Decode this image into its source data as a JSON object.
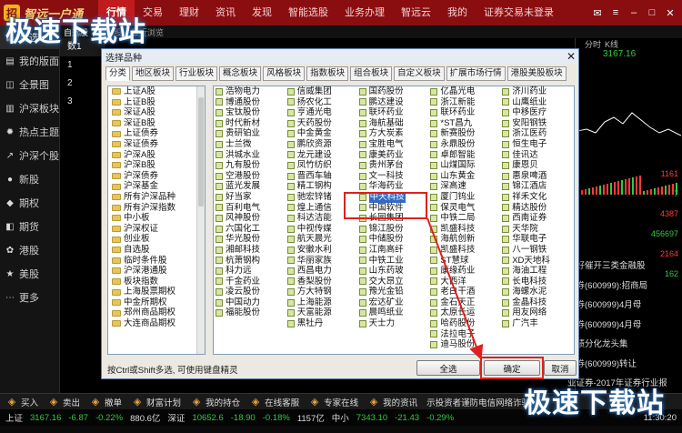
{
  "app": {
    "logo_text": "智远一户通",
    "logo_mark": "招"
  },
  "topnav": {
    "items": [
      "行情",
      "交易",
      "理财",
      "资讯",
      "发现",
      "智能选股",
      "业务办理",
      "智远云",
      "我的",
      "证券交易未登录"
    ],
    "active_index": 0
  },
  "sidebar": {
    "items": [
      {
        "label": "自选",
        "icon": "grid-icon"
      },
      {
        "label": "我的版面",
        "icon": "layout-icon"
      },
      {
        "label": "全景图",
        "icon": "panorama-icon"
      },
      {
        "label": "沪深板块",
        "icon": "block-icon"
      },
      {
        "label": "热点主题",
        "icon": "fire-icon"
      },
      {
        "label": "沪深个股",
        "icon": "chart-icon"
      },
      {
        "label": "新股",
        "icon": "new-icon"
      },
      {
        "label": "期权",
        "icon": "option-icon"
      },
      {
        "label": "期货",
        "icon": "futures-icon"
      },
      {
        "label": "港股",
        "icon": "hk-icon"
      },
      {
        "label": "美股",
        "icon": "us-icon"
      },
      {
        "label": "更多",
        "icon": "more-icon"
      }
    ]
  },
  "subtabs": [
    "自选股",
    "持仓股",
    "最近浏览"
  ],
  "main_table": {
    "header": "数1",
    "rows": [
      "1",
      "2",
      "3"
    ]
  },
  "right_panel": {
    "tabs": [
      "分时",
      "K线"
    ],
    "price": "3167.16",
    "numbers": [
      "1161",
      "7",
      "4387",
      "456697",
      "2164",
      "162"
    ]
  },
  "news": [
    "财好催开三类金融股",
    "证券(600999):招商局",
    "证券(600999)4月母",
    "证券(600999)4月母",
    "业绩分化龙头集",
    "证券(600999)转让",
    "业证券-2017年证券行业报",
    "证券(600999)一季度",
    "证券业前最快的"
  ],
  "dialog": {
    "title": "选择品种",
    "tabs": [
      "分类",
      "地区板块",
      "行业板块",
      "概念板块",
      "风格板块",
      "指数板块",
      "组合板块",
      "自定义板块",
      "扩展市场行情",
      "港股美股板块"
    ],
    "categories": [
      "上证A股",
      "上证B股",
      "深证A股",
      "深证B股",
      "上证债券",
      "深证债券",
      "沪深A股",
      "沪深B股",
      "沪深债券",
      "沪深基金",
      "所有沪深品种",
      "所有沪深指数",
      "中小板",
      "沪深权证",
      "创业板",
      "自选股",
      "临时条件股",
      "沪深港通股",
      "板块指数",
      "上海股票期权",
      "中金所期权",
      "郑州商品期权",
      "大连商品期权"
    ],
    "stock_columns": [
      [
        "浩物电力",
        "博通股份",
        "宝钛股份",
        "时代新材",
        "贵研铂业",
        "士兰微",
        "洪城水业",
        "九有股份",
        "空港股份",
        "蓝光发展",
        "好当家",
        "百利电气",
        "风神股份",
        "六国化工",
        "华光股份",
        "湘邮科技",
        "杭萧钢构",
        "科力远",
        "千金药业",
        "凌云股份",
        "中国动力",
        "福能股份"
      ],
      [
        "信威集团",
        "扬农化工",
        "亨通光电",
        "天药股份",
        "中金黄金",
        "鹏欣资源",
        "龙元建设",
        "凤竹纺织",
        "晋西车轴",
        "精工钢构",
        "驰宏锌锗",
        "煌上通信",
        "科达洁能",
        "中视传媒",
        "航天晨光",
        "安徽水利",
        "华丽家族",
        "西昌电力",
        "香梨股份",
        "方大特钢",
        "上海能源",
        "天富能源",
        "黑牡丹"
      ],
      [
        "国药股份",
        "鹏达建设",
        "联环药业",
        "海航基础",
        "方大炭素",
        "宝胜电气",
        "康美药业",
        "贵州茅台",
        "文一科技",
        "华海药业",
        "中天科技",
        "中国软件",
        "长园集团",
        "锦江股份",
        "中储股份",
        "江南高纤",
        "中铁工业",
        "山东药玻",
        "交大昂立",
        "豫光金铅",
        "宏达矿业",
        "晨鸣纸业",
        "天士力"
      ],
      [
        "亿晶光电",
        "浙江新能",
        "联环药业",
        "*ST昌九",
        "新赛股份",
        "永鼎股份",
        "卓郎智能",
        "山煤国际",
        "山东黄金",
        "深高速",
        "厦门钨业",
        "保灵电气",
        "中铁二局",
        "凯盛科技",
        "海航创新",
        "凯盛科技",
        "ST慧球",
        "康缘药业",
        "大西洋",
        "老白干酒",
        "金石天正",
        "太原长运",
        "哈药股份",
        "法拉电子",
        "迪马股份"
      ],
      [
        "济川药业",
        "山鹰纸业",
        "中移医疗",
        "安阳钢铁",
        "浙江医药",
        "恒生电子",
        "佳讯达",
        "康恩贝",
        "惠泉啤酒",
        "锦江酒店",
        "祥禾文化",
        "精达股份",
        "西南证券",
        "天华院",
        "华联电子",
        "八一钢铁",
        "XD天地科",
        "海油工程",
        "长电科技",
        "海螺水泥",
        "金晶科技",
        "用友网络",
        "广汽丰"
      ]
    ],
    "selected_stock": "中天科技",
    "hint": "按Ctrl或Shift多选, 可使用键盘精灵",
    "buttons": {
      "select_all": "全选",
      "confirm": "确定",
      "cancel": "取消"
    }
  },
  "bottombar": {
    "items": [
      "买入",
      "卖出",
      "撤单",
      "财富计划",
      "我的持仓",
      "在线客服",
      "专家在线",
      "我的资讯"
    ],
    "scroll_text": "示投资者谨防电信网络诈骗"
  },
  "ticker": {
    "items": [
      {
        "label": "上证",
        "value": "3167.16",
        "change": "-6.87",
        "pct": "-0.22%",
        "amount": "880.6亿"
      },
      {
        "label": "深证",
        "value": "10652.6",
        "change": "-18.90",
        "pct": "-0.18%",
        "amount": "1157亿"
      },
      {
        "label": "中小",
        "value": "7343.10",
        "change": "-21.43",
        "pct": "-0.29%"
      }
    ],
    "time": "11:30:20"
  },
  "watermark": "极速下载站",
  "colors": {
    "topbar": "#8a0e10",
    "accent": "#c01c1f",
    "highlight": "#e0201c",
    "selection": "#316ac5"
  }
}
